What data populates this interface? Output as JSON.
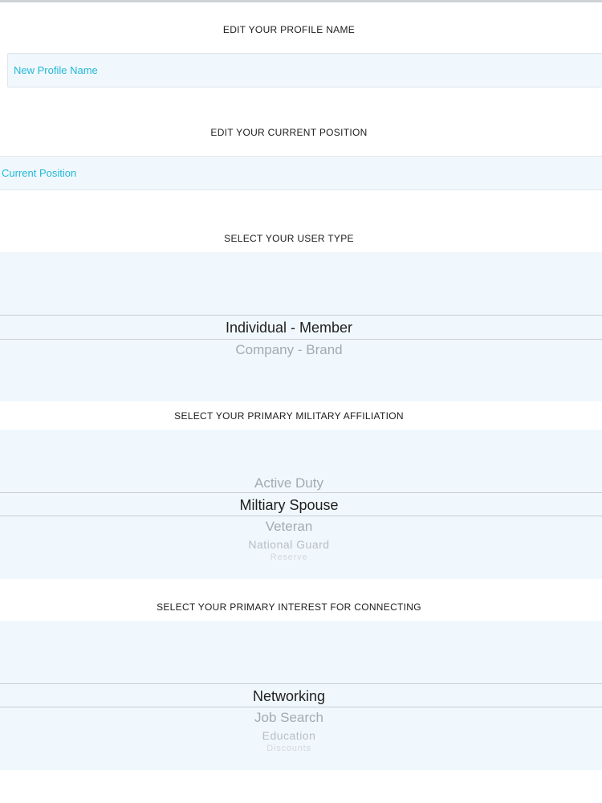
{
  "profile_name": {
    "title": "EDIT YOUR PROFILE NAME",
    "placeholder": "New Profile Name"
  },
  "current_position": {
    "title": "EDIT YOUR CURRENT POSITION",
    "placeholder": "Current Position"
  },
  "user_type": {
    "title": "SELECT YOUR USER TYPE",
    "selected": "Individual - Member",
    "below": [
      "Company - Brand"
    ]
  },
  "military_affiliation": {
    "title": "SELECT YOUR PRIMARY MILITARY AFFILIATION",
    "above": [
      "Active Duty"
    ],
    "selected": "Miltiary Spouse",
    "below": [
      "Veteran",
      "National Guard",
      "Reserve"
    ]
  },
  "primary_interest": {
    "title": "SELECT YOUR PRIMARY INTEREST FOR CONNECTING",
    "selected": "Networking",
    "below": [
      "Job Search",
      "Education",
      "Discounts"
    ]
  }
}
